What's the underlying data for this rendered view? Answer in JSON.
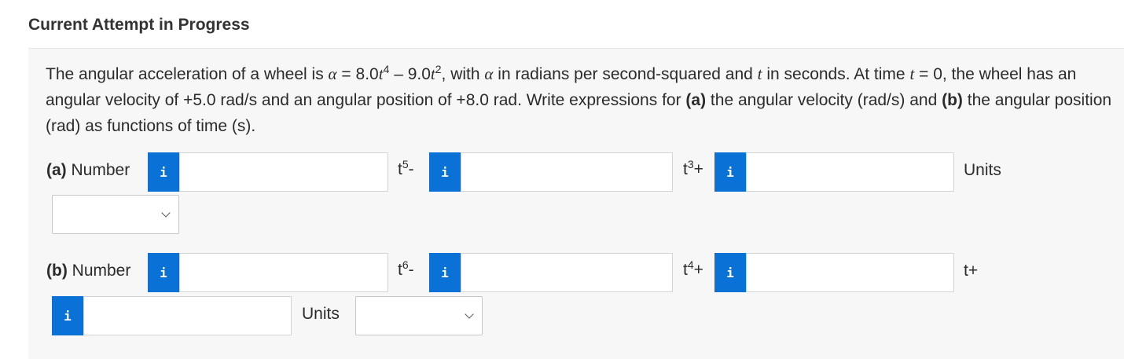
{
  "header": {
    "title": "Current Attempt in Progress"
  },
  "question": {
    "p1": "The angular acceleration of a wheel is ",
    "alpha1": "α",
    "p2": " = 8.0",
    "t1": "t",
    "e1": "4",
    "p3": " – 9.0",
    "t2": "t",
    "e2": "2",
    "p4": ", with ",
    "alpha2": "α",
    "p5": " in radians per second-squared and ",
    "t3": "t",
    "p6": " in seconds. At time ",
    "t4": "t",
    "p7": " = 0, the wheel has an angular velocity of +5.0 rad/s and an angular position of +8.0 rad. Write expressions for ",
    "a_bold": "(a)",
    "p8": " the angular velocity (rad/s) and ",
    "b_bold": "(b)",
    "p9": " the angular position (rad) as functions of time (s)."
  },
  "part_a": {
    "label_bold": "(a)",
    "label_text": " Number",
    "info_icon": "i",
    "term1_base": "t",
    "term1_exp": "5",
    "term1_op": "-",
    "term2_base": "t",
    "term2_exp": "3",
    "term2_op": "+",
    "units_label": "Units",
    "units_select_value": ""
  },
  "part_b": {
    "label_bold": "(b)",
    "label_text": " Number",
    "info_icon": "i",
    "term1_base": "t",
    "term1_exp": "6",
    "term1_op": "-",
    "term2_base": "t",
    "term2_exp": "4",
    "term2_op": "+",
    "term3": "t+",
    "units_label": "Units",
    "units_select_value": ""
  },
  "colors": {
    "info_button": "#0a72d6",
    "panel_bg": "#f7f7f7"
  }
}
